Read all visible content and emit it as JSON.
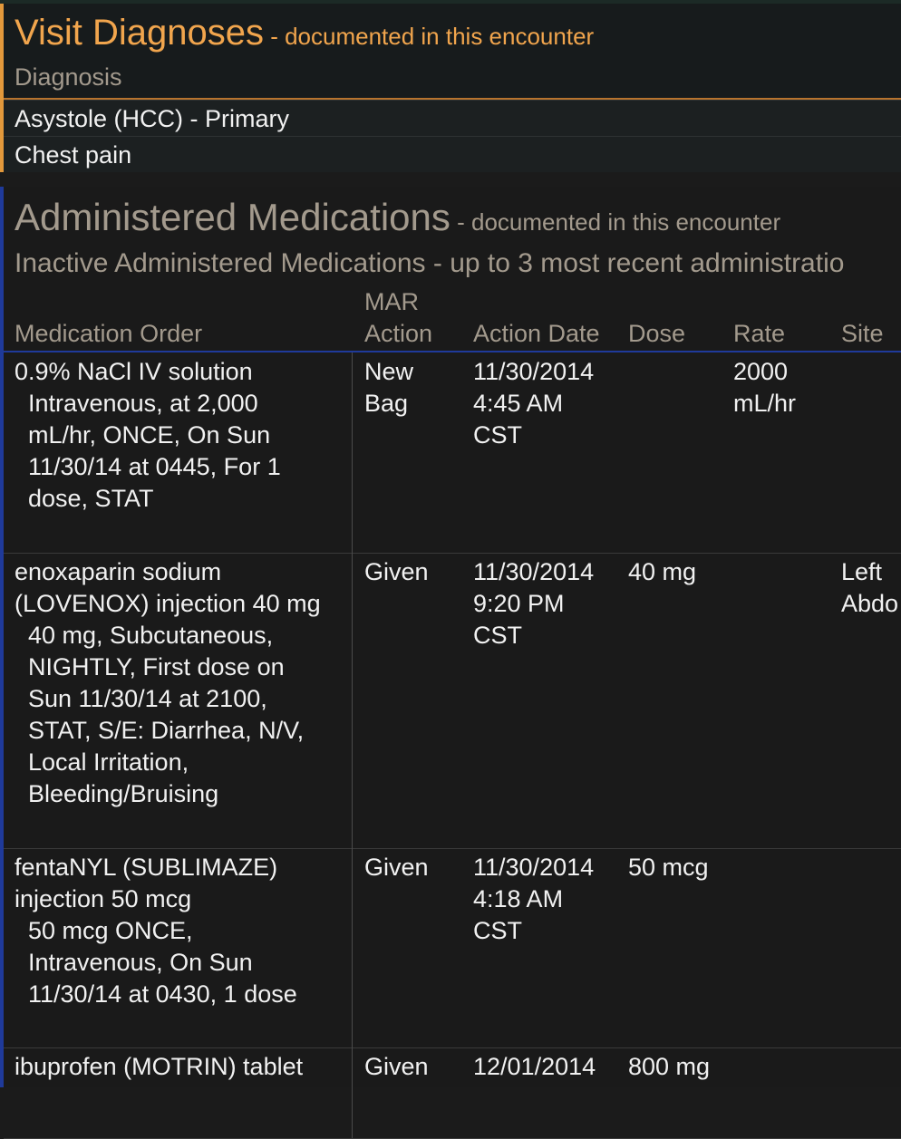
{
  "diagnoses": {
    "title": "Visit Diagnoses",
    "subtitle": " - documented in this encounter",
    "column_header": "Diagnosis",
    "rows": [
      "Asystole (HCC) - Primary",
      "Chest pain"
    ],
    "accent_color": "#f1a54d"
  },
  "medications": {
    "title": "Administered Medications",
    "subtitle": " - documented in this encounter",
    "inactive_label": "Inactive Administered Medications - up to 3 most recent administratio",
    "headers": {
      "order": "Medication Order",
      "mar1": "MAR",
      "mar2": "Action",
      "date": "Action Date",
      "dose": "Dose",
      "rate": "Rate",
      "site": "Site"
    },
    "rows": [
      {
        "order": [
          "0.9% NaCl IV solution",
          "  Intravenous, at 2,000",
          "  mL/hr, ONCE, On Sun",
          "  11/30/14 at 0445, For 1",
          "  dose, STAT"
        ],
        "action": [
          "New",
          "Bag"
        ],
        "date": [
          "11/30/2014",
          "4:45 AM",
          "CST"
        ],
        "dose": [],
        "rate": [
          "2000",
          "mL/hr"
        ],
        "site": []
      },
      {
        "order": [
          "enoxaparin sodium",
          "(LOVENOX) injection 40 mg",
          "  40 mg, Subcutaneous,",
          "  NIGHTLY, First dose on",
          "  Sun 11/30/14 at 2100,",
          "  STAT, S/E: Diarrhea, N/V,",
          "  Local Irritation,",
          "  Bleeding/Bruising"
        ],
        "action": [
          "Given"
        ],
        "date": [
          "11/30/2014",
          "9:20 PM",
          "CST"
        ],
        "dose": [
          "40 mg"
        ],
        "rate": [],
        "site": [
          "Left",
          "Abdo"
        ]
      },
      {
        "order": [
          "fentaNYL (SUBLIMAZE)",
          "injection 50 mcg",
          "  50 mcg ONCE,",
          "  Intravenous, On Sun",
          "  11/30/14 at 0430, 1 dose"
        ],
        "action": [
          "Given"
        ],
        "date": [
          "11/30/2014",
          "4:18 AM",
          "CST"
        ],
        "dose": [
          "50 mcg"
        ],
        "rate": [],
        "site": []
      },
      {
        "order": [
          "ibuprofen (MOTRIN) tablet"
        ],
        "action": [
          "Given"
        ],
        "date": [
          "12/01/2014"
        ],
        "dose": [
          "800 mg"
        ],
        "rate": [],
        "site": []
      }
    ]
  }
}
